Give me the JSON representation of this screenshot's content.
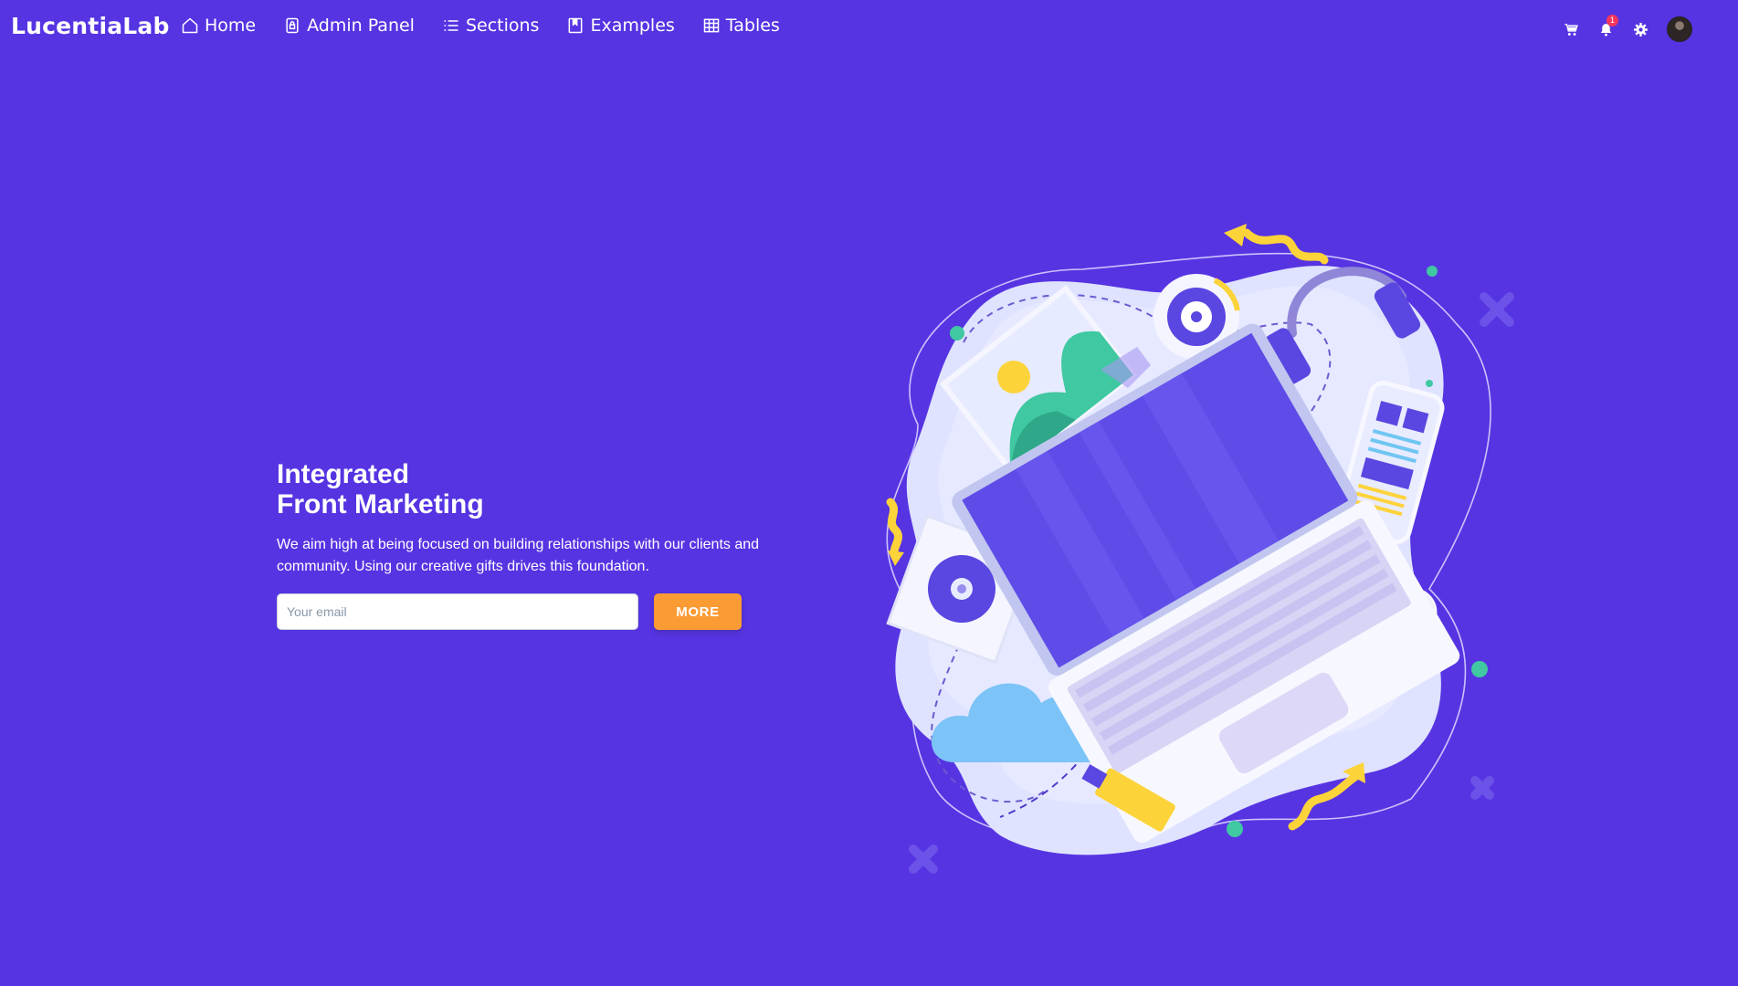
{
  "navbar": {
    "brand": "LucentiaLab",
    "items": [
      {
        "label": "Home",
        "icon": "home-icon"
      },
      {
        "label": "Admin Panel",
        "icon": "lock-icon"
      },
      {
        "label": "Sections",
        "icon": "list-icon"
      },
      {
        "label": "Examples",
        "icon": "book-icon"
      },
      {
        "label": "Tables",
        "icon": "table-icon"
      }
    ],
    "right": {
      "cart_icon": "cart-icon",
      "bell_icon": "bell-icon",
      "notification_count": "1",
      "settings_icon": "gear-icon",
      "avatar": "avatar"
    }
  },
  "hero": {
    "title_line1": "Integrated",
    "title_line2": "Front Marketing",
    "description": "We aim high at being focused on building relationships with our clients and community. Using our creative gifts drives this foundation.",
    "email_placeholder": "Your email",
    "button_label": "MORE"
  },
  "colors": {
    "background": "#5634e2",
    "button": "#fb9b34",
    "badge": "#f5365c"
  }
}
